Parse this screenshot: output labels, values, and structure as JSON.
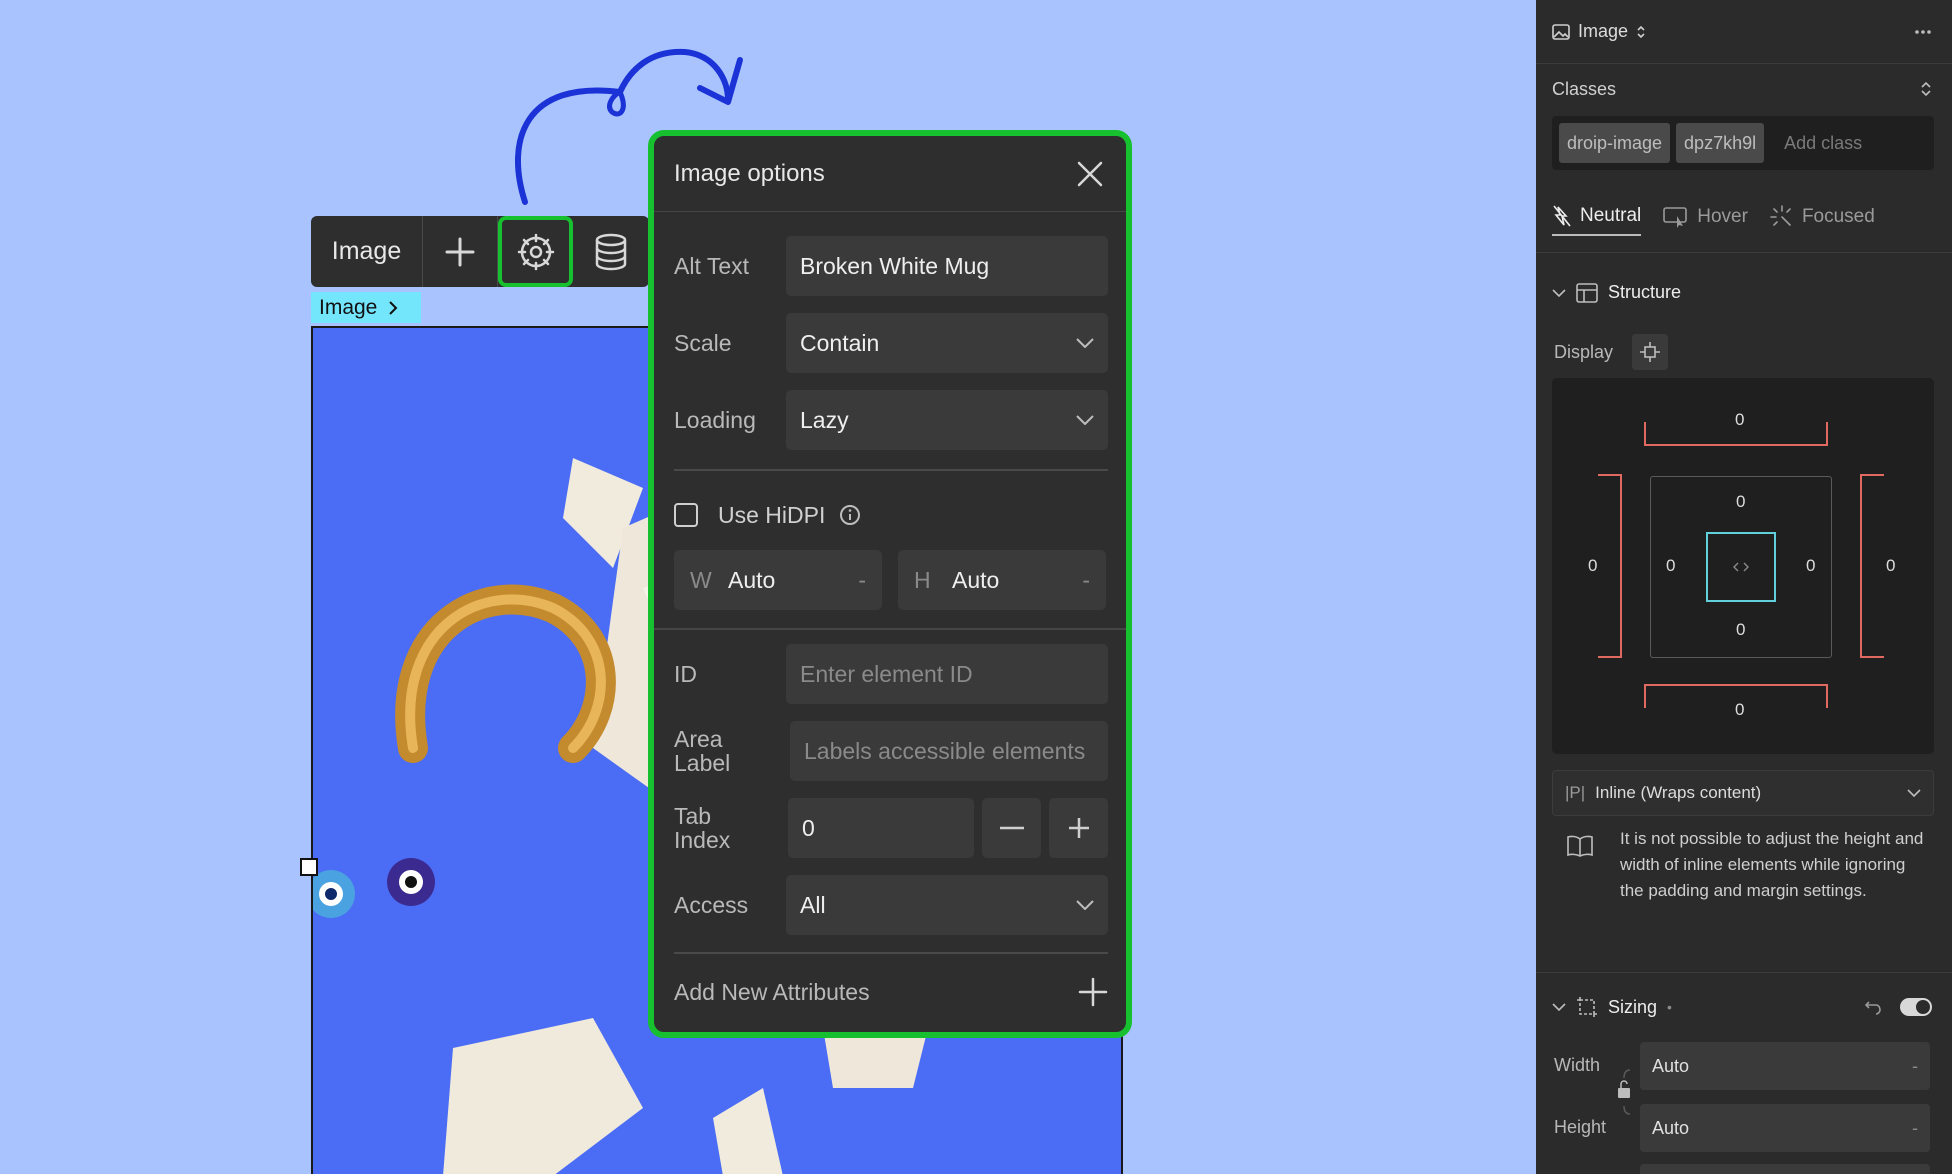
{
  "toolbar": {
    "element_label": "Image"
  },
  "breadcrumb": {
    "label": "Image"
  },
  "options": {
    "title": "Image options",
    "alt_text": {
      "label": "Alt Text",
      "value": "Broken White Mug"
    },
    "scale": {
      "label": "Scale",
      "value": "Contain"
    },
    "loading": {
      "label": "Loading",
      "value": "Lazy"
    },
    "hidpi": {
      "label": "Use HiDPI",
      "checked": false
    },
    "width": {
      "label": "W",
      "value": "Auto",
      "unit": "-"
    },
    "height": {
      "label": "H",
      "value": "Auto",
      "unit": "-"
    },
    "id": {
      "label": "ID",
      "placeholder": "Enter element ID"
    },
    "area_label": {
      "label_line1": "Area",
      "label_line2": "Label",
      "placeholder": "Labels accessible elements"
    },
    "tab_index": {
      "label_line1": "Tab",
      "label_line2": "Index",
      "value": "0"
    },
    "access": {
      "label": "Access",
      "value": "All"
    },
    "add_attributes": {
      "label": "Add New Attributes"
    }
  },
  "rpanel": {
    "element_type": "Image",
    "classes_label": "Classes",
    "classes": [
      "droip-image",
      "dpz7kh9l"
    ],
    "add_class_placeholder": "Add class",
    "states": [
      "Neutral",
      "Hover",
      "Focused"
    ],
    "structure_label": "Structure",
    "display_label": "Display",
    "box_model": {
      "margin_top": "0",
      "margin_right": "0",
      "margin_bottom": "0",
      "margin_left": "0",
      "padding_top": "0",
      "padding_right": "0",
      "padding_bottom": "0",
      "padding_left": "0"
    },
    "display_mode": {
      "tag": "|P|",
      "value": "Inline (Wraps content)"
    },
    "inline_notice": "It is not possible to adjust the height and width of inline elements while ignoring the padding and margin settings.",
    "sizing_label": "Sizing",
    "sizing_dot": "•",
    "width": {
      "label": "Width",
      "value": "Auto",
      "unit": "-"
    },
    "height": {
      "label": "Height",
      "value": "Auto",
      "unit": "-"
    }
  },
  "colors": {
    "canvas_bg": "#a9c3fe",
    "image_bg": "#4b6cf4",
    "highlight_green": "#17c02e",
    "panel_bg": "#2e2e2e",
    "breadcrumb_bg": "#74e6fb",
    "margin_red": "#e06a5f",
    "padding_cyan": "#5fd0dc",
    "annotation_blue": "#1b33d6"
  }
}
